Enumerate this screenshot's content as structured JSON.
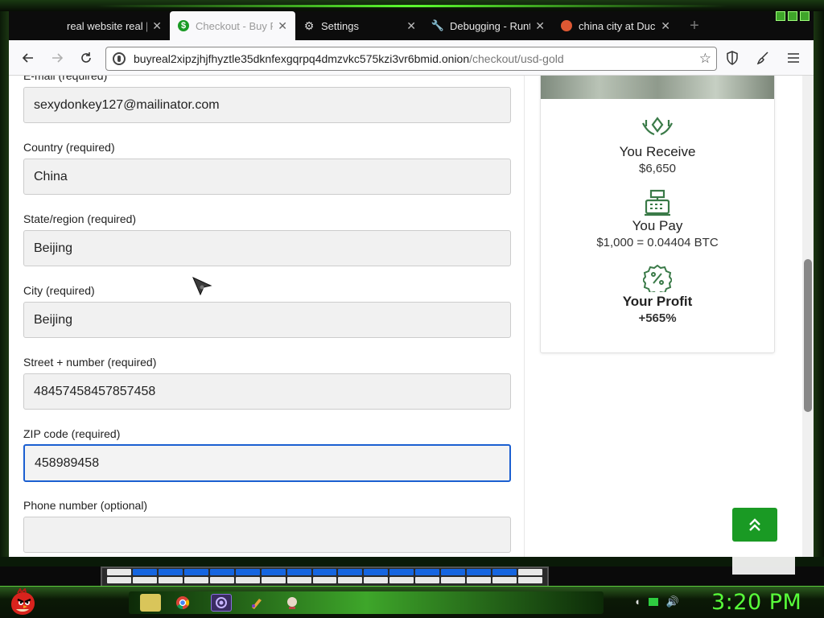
{
  "browser": {
    "tabs": [
      {
        "label": "real website real | T",
        "active": false,
        "icon": "none"
      },
      {
        "label": "Checkout - Buy Re",
        "active": true,
        "icon": "dollar-icon"
      },
      {
        "label": "Settings",
        "active": false,
        "icon": "gear-icon"
      },
      {
        "label": "Debugging - Runtir",
        "active": false,
        "icon": "wrench-icon"
      },
      {
        "label": "china city at DuckD",
        "active": false,
        "icon": "duckduckgo-icon"
      }
    ],
    "url_host": "buyreal2xipzjhjfhyztle35dknfexgqrpq4dmzvkc575kzi3vr6bmid.onion",
    "url_path": "/checkout/usd-gold"
  },
  "form": {
    "email": {
      "label": "E-mail (required)",
      "value": "sexydonkey127@mailinator.com"
    },
    "country": {
      "label": "Country (required)",
      "value": "China"
    },
    "state": {
      "label": "State/region (required)",
      "value": "Beijing"
    },
    "city": {
      "label": "City (required)",
      "value": "Beijing"
    },
    "street": {
      "label": "Street + number (required)",
      "value": "48457458457857458"
    },
    "zip": {
      "label": "ZIP code (required)",
      "value": "458989458"
    },
    "phone": {
      "label": "Phone number (optional)",
      "value": ""
    }
  },
  "summary": {
    "receive_title": "You Receive",
    "receive_value": "$6,650",
    "pay_title": "You Pay",
    "pay_value": "$1,000 = 0.04404 BTC",
    "profit_title": "Your Profit",
    "profit_value": "+565%"
  },
  "taskbar": {
    "clock": "3:20 PM"
  },
  "colors": {
    "accent_green": "#1a9a24",
    "icon_green": "#3a7a48",
    "focus_blue": "#1b5fd1",
    "clock_green": "#58ff3a"
  }
}
